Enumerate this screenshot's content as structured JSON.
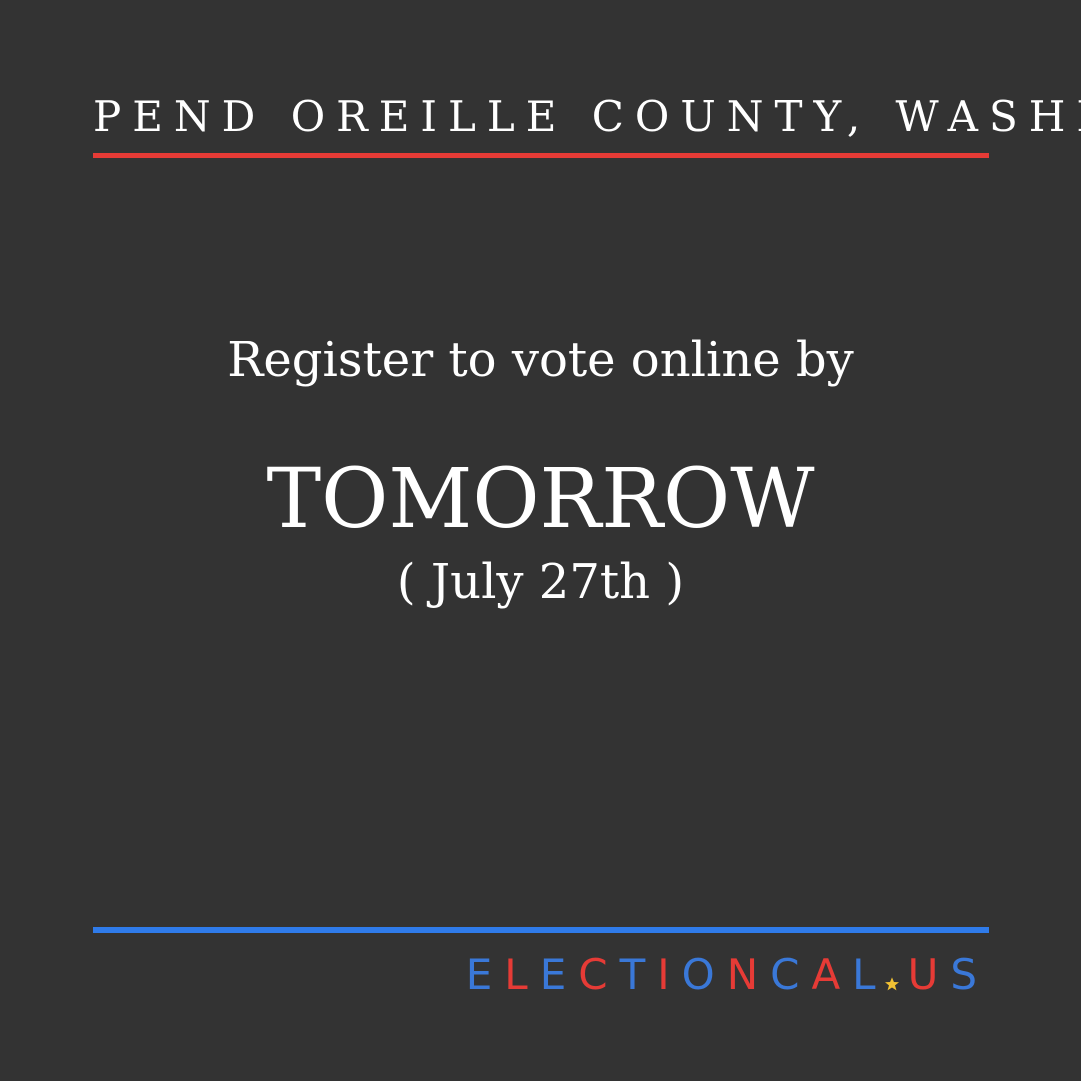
{
  "header": {
    "location": "PEND OREILLE COUNTY, WASHINGTON"
  },
  "message": {
    "intro": "Register to vote online by",
    "deadline": "TOMORROW",
    "date": "( July 27th )"
  },
  "brand": {
    "name_part1": "ELECTIONCAL",
    "name_part2": "US",
    "separator_icon": "star-icon"
  },
  "colors": {
    "background": "#333333",
    "red_accent": "#e63b36",
    "blue_accent": "#2f7bea",
    "star": "#f2c233",
    "text": "#ffffff"
  }
}
